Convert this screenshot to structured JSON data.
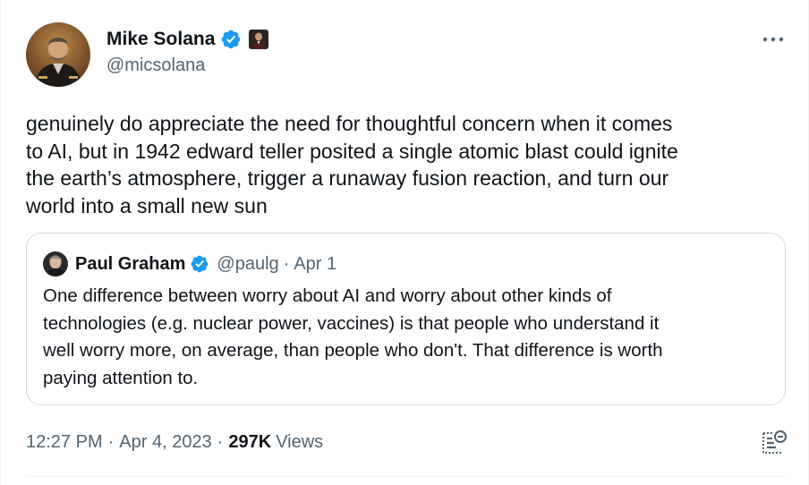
{
  "author": {
    "display_name": "Mike Solana",
    "handle": "@micsolana",
    "avatar_icon": "portrait-avatar-icon",
    "verified_icon": "verified-badge-icon",
    "affiliate_icon": "affiliate-badge-icon"
  },
  "more_icon": "more-horizontal-icon",
  "tweet_text": "genuinely do appreciate the need for thoughtful concern when it comes\nto AI, but in 1942 edward teller posited a single atomic blast could ignite\nthe earth’s atmosphere, trigger a runaway fusion reaction, and turn our\nworld into a small new sun",
  "quoted": {
    "display_name": "Paul Graham",
    "handle": "@paulg",
    "separator": "·",
    "date": "Apr 1",
    "text": "One difference between worry about AI and worry about other kinds of\ntechnologies (e.g. nuclear power, vaccines) is that people who understand it\nwell worry more, on average, than people who don't. That difference is worth\npaying attention to."
  },
  "meta": {
    "time": "12:27 PM",
    "separator": "·",
    "date": "Apr 4, 2023",
    "views_count": "297K",
    "views_label": "Views"
  },
  "translate_icon": "translate-post-icon",
  "colors": {
    "text": "#0f1419",
    "secondary": "#536471",
    "verified_blue": "#1d9bf0",
    "border": "#cfd9de"
  }
}
